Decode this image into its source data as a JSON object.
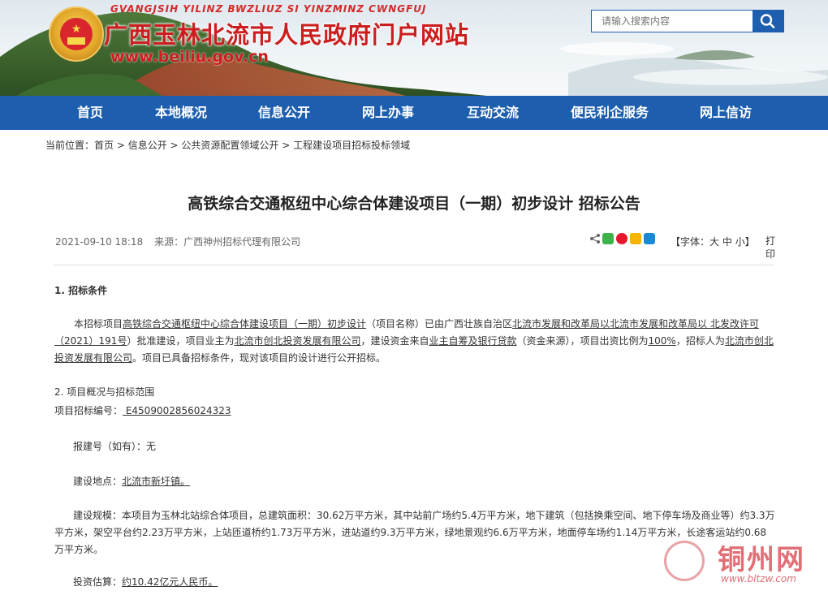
{
  "header": {
    "pinyin": "GVANGJSIH YILINZ BWZLIUZ SI YINZMINZ CWNGFUJ",
    "site_title": "广西玉林北流市人民政府门户网站",
    "site_url": "www.beiliu.gov.cn",
    "search_placeholder": "请输入搜索内容",
    "emblem_icon": "national-emblem-icon"
  },
  "nav": {
    "items": [
      "首页",
      "本地概况",
      "信息公开",
      "网上办事",
      "互动交流",
      "便民利企服务",
      "网上信访"
    ]
  },
  "breadcrumb": {
    "prefix": "当前位置：",
    "items": [
      "首页",
      "信息公开",
      "公共资源配置领域公开",
      "工程建设项目招标投标领域"
    ],
    "separator": " > "
  },
  "article": {
    "title": "高铁综合交通枢纽中心综合体建设项目（一期）初步设计 招标公告",
    "date": "2021-09-10 18:18",
    "source": "来源：广西神州招标代理有限公司",
    "font_label": "【字体：",
    "font_large": "大",
    "font_medium": "中",
    "font_small": "小",
    "font_close": "】",
    "print": "打印",
    "section1": "1. 招标条件",
    "p1": {
      "a": "本招标项目",
      "b": "高铁综合交通枢纽中心综合体建设项目（一期）初步设计",
      "c": "（项目名称）已由广西壮族自治区",
      "d": "北流市发展和改革局以北流市发展和改革局以 北发改许可（2021）191号",
      "e": "）批准建设，项目业主为",
      "f": "北流市创北投资发展有限公司",
      "g": "，建设资金来自",
      "h": "业主自筹及银行贷款",
      "i": "（资金来源），项目出资比例为",
      "j": "100%",
      "k": "，招标人为",
      "l": "北流市创北投资发展有限公司",
      "m": "。项目已具备招标条件，现对该项目的设计进行公开招标。"
    },
    "section2": "2. 项目概况与招标范围",
    "project_no_label": "项目招标编号：",
    "project_no": " E4509002856024323 ",
    "report_no_label": "报建号（如有）：",
    "report_no": "无",
    "location_label": "建设地点：",
    "location": "北流市新圩镇。",
    "scale_label": "建设规模：",
    "scale": "本项目为玉林北站综合体项目，总建筑面积：30.62万平方米，其中站前广场约5.4万平方米，地下建筑（包括换乘空间、地下停车场及商业等）约3.3万平方米，架空平台约2.23万平方米，上站匝道桥约1.73万平方米，进站道约9.3万平方米，绿地景观约6.6万平方米，地面停车场约1.14万平方米，长途客运站约0.68万平方米。",
    "investment_label": "投资估算：",
    "investment": "约10.42亿元人民币。"
  },
  "watermark": {
    "text": "铜州网",
    "url": "www.bltzw.com"
  },
  "colors": {
    "nav": "#1d5fae",
    "title_red": "#cc1e1e"
  }
}
